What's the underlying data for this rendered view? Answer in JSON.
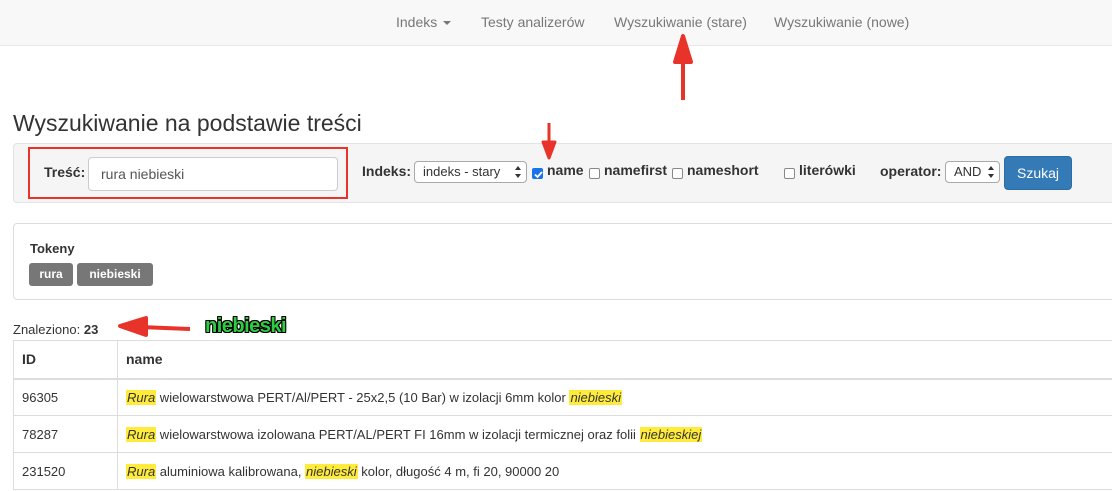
{
  "navbar": {
    "items": [
      {
        "label": "Indeks"
      },
      {
        "label": "Testy analizerów"
      },
      {
        "label": "Wyszukiwanie (stare)"
      },
      {
        "label": "Wyszukiwanie (nowe)"
      }
    ]
  },
  "page_title": "Wyszukiwanie na podstawie treści",
  "form": {
    "tresc_label": "Treść:",
    "tresc_value": "rura niebieski",
    "indeks_label": "Indeks:",
    "indeks_selected": "indeks - stary",
    "checkboxes": [
      {
        "label": "name",
        "checked": true
      },
      {
        "label": "namefirst",
        "checked": false
      },
      {
        "label": "nameshort",
        "checked": false
      },
      {
        "label": "literówki",
        "checked": false
      }
    ],
    "operator_label": "operator:",
    "operator_selected": "AND",
    "search_button": "Szukaj"
  },
  "tokens_panel": {
    "title": "Tokeny",
    "tokens": [
      "rura",
      "niebieski"
    ]
  },
  "results": {
    "found_label": "Znaleziono:",
    "found_count": "23",
    "columns": [
      "ID",
      "name"
    ],
    "rows": [
      {
        "id": "96305",
        "parts": [
          {
            "t": "Rura",
            "hl": true
          },
          {
            "t": " wielowarstwowa PERT/Al/PERT - 25x2,5 (10 Bar) w izolacji 6mm kolor ",
            "hl": false
          },
          {
            "t": "niebieski",
            "hl": true
          }
        ]
      },
      {
        "id": "78287",
        "parts": [
          {
            "t": "Rura",
            "hl": true
          },
          {
            "t": " wielowarstwowa izolowana PERT/AL/PERT FI 16mm w izolacji termicznej oraz folii ",
            "hl": false
          },
          {
            "t": "niebieskiej",
            "hl": true
          }
        ]
      },
      {
        "id": "231520",
        "parts": [
          {
            "t": "Rura",
            "hl": true
          },
          {
            "t": " aluminiowa kalibrowana, ",
            "hl": false
          },
          {
            "t": "niebieski",
            "hl": true
          },
          {
            "t": " kolor, długość 4 m, fi 20, 90000 20",
            "hl": false
          }
        ]
      }
    ]
  },
  "annotation": {
    "label": "niebieski",
    "arrow_color": "#e8332a",
    "label_color": "#2ecc40"
  },
  "colors": {
    "primary": "#337ab7",
    "highlight": "#ffeb3b",
    "token_bg": "#777777"
  }
}
